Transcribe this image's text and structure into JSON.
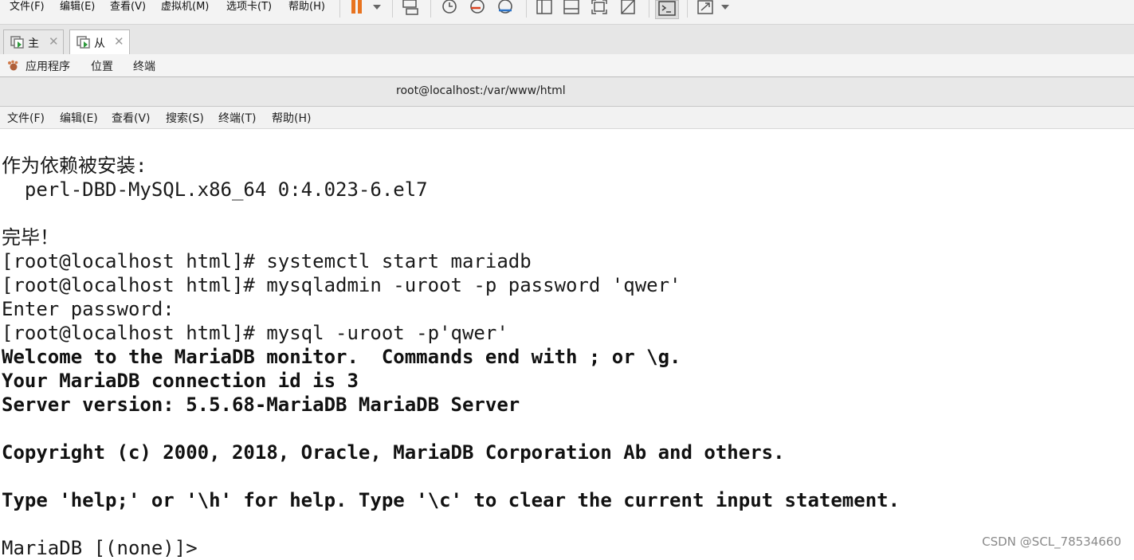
{
  "vm_menu": [
    "文件(F)",
    "编辑(E)",
    "查看(V)",
    "虚拟机(M)",
    "选项卡(T)",
    "帮助(H)"
  ],
  "tabs": [
    {
      "label": "主",
      "active": false
    },
    {
      "label": "从",
      "active": true
    }
  ],
  "gnome_bar": {
    "apps": "应用程序",
    "places": "位置",
    "terminal": "终端"
  },
  "terminal_title": "root@localhost:/var/www/html",
  "terminal_menu": [
    "文件(F)",
    "编辑(E)",
    "查看(V)",
    "搜索(S)",
    "终端(T)",
    "帮助(H)"
  ],
  "terminal_lines": [
    "作为依赖被安装:",
    "  perl-DBD-MySQL.x86_64 0:4.023-6.el7",
    "",
    "完毕！",
    "[root@localhost html]# systemctl start mariadb",
    "[root@localhost html]# mysqladmin -uroot -p password 'qwer'",
    "Enter password:",
    "[root@localhost html]# mysql -uroot -p'qwer'",
    "Welcome to the MariaDB monitor.  Commands end with ; or \\g.",
    "Your MariaDB connection id is 3",
    "Server version: 5.5.68-MariaDB MariaDB Server",
    "",
    "Copyright (c) 2000, 2018, Oracle, MariaDB Corporation Ab and others.",
    "",
    "Type 'help;' or '\\h' for help. Type '\\c' to clear the current input statement.",
    "",
    "MariaDB [(none)]>"
  ],
  "watermark": "CSDN @SCL_78534660"
}
